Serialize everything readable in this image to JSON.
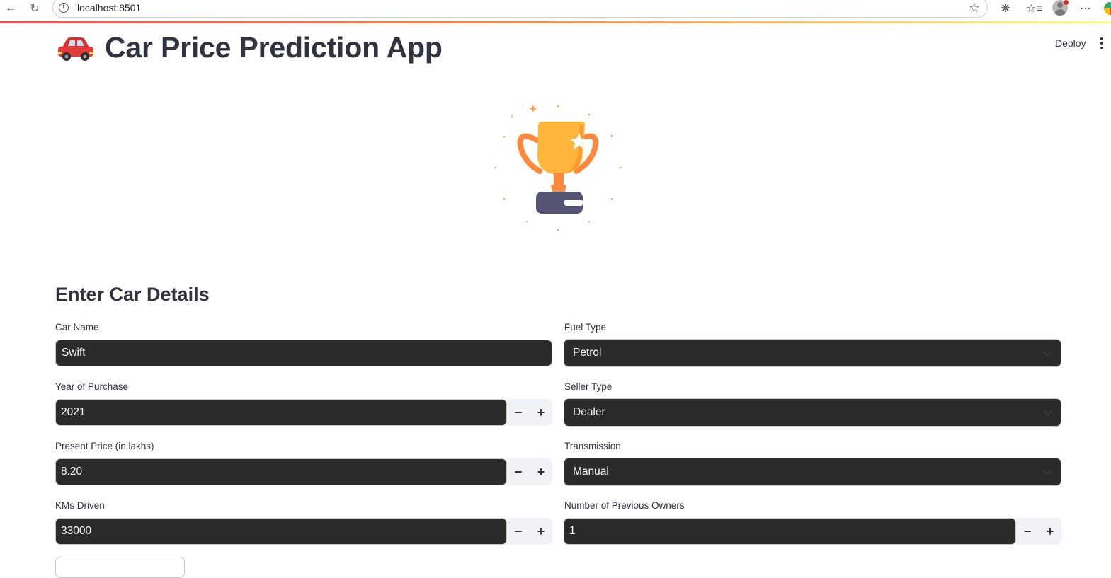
{
  "browser": {
    "url": "localhost:8501"
  },
  "header": {
    "deploy_label": "Deploy"
  },
  "app": {
    "title": "Car Price Prediction App",
    "subheader": "Enter Car Details"
  },
  "form": {
    "car_name": {
      "label": "Car Name",
      "value": "Swift"
    },
    "year": {
      "label": "Year of Purchase",
      "value": "2021"
    },
    "present_price": {
      "label": "Present Price (in lakhs)",
      "value": "8.20"
    },
    "kms_driven": {
      "label": "KMs Driven",
      "value": "33000"
    },
    "fuel_type": {
      "label": "Fuel Type",
      "value": "Petrol"
    },
    "seller_type": {
      "label": "Seller Type",
      "value": "Dealer"
    },
    "transmission": {
      "label": "Transmission",
      "value": "Manual"
    },
    "owners": {
      "label": "Number of Previous Owners",
      "value": "1"
    },
    "stepper_minus": "−",
    "stepper_plus": "+"
  },
  "colors": {
    "accent": "#ff4b4b",
    "input_bg": "#2b2b2b",
    "text": "#31333f"
  }
}
